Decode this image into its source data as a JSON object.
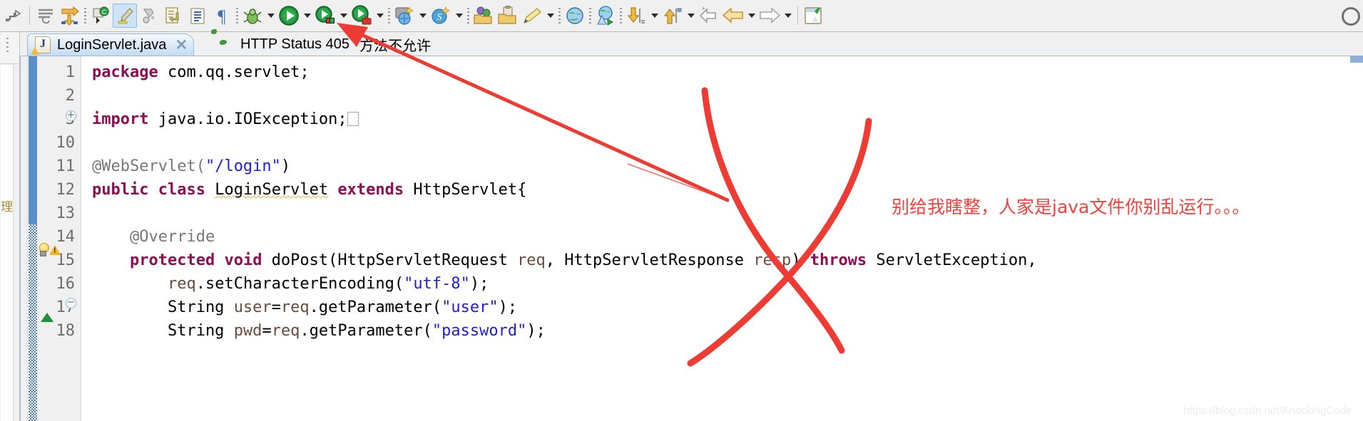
{
  "toolbar": {
    "items": [
      {
        "name": "link-with-editor-icon",
        "glyph": "↱"
      },
      {
        "name": "toggle-mark-occurrences-icon",
        "glyph": "≡"
      },
      {
        "name": "skip-all-breakpoints-icon",
        "glyph": "↠"
      },
      {
        "name": "new-java-class-icon",
        "glyph": "Ⓒ"
      },
      {
        "name": "toggle-highlight-icon",
        "glyph": "✎"
      },
      {
        "name": "toggle-block-selection-icon",
        "glyph": "❖"
      },
      {
        "name": "next-annotation-icon",
        "glyph": "↵"
      },
      {
        "name": "show-whitespace-icon",
        "glyph": "☰"
      },
      {
        "name": "paragraph-mark-icon",
        "glyph": "¶"
      },
      {
        "name": "debug-icon",
        "glyph": "🐞"
      },
      {
        "name": "run-icon",
        "glyph": "▶"
      },
      {
        "name": "run-external-tools-icon",
        "glyph": "▶"
      },
      {
        "name": "run-coverage-icon",
        "glyph": "▶"
      },
      {
        "name": "new-web-project-icon",
        "glyph": "✦"
      },
      {
        "name": "new-spring-bean-icon",
        "glyph": "✦"
      },
      {
        "name": "open-type-icon",
        "glyph": "📂"
      },
      {
        "name": "open-task-icon",
        "glyph": "📁"
      },
      {
        "name": "new-task-icon",
        "glyph": "✏"
      },
      {
        "name": "open-web-browser-icon",
        "glyph": "🌐"
      },
      {
        "name": "run-on-server-icon",
        "glyph": "🌍"
      },
      {
        "name": "previous-edit-location-icon",
        "glyph": "⬇"
      },
      {
        "name": "next-edit-location-icon",
        "glyph": "⬆"
      },
      {
        "name": "back-new-icon",
        "glyph": "↩"
      },
      {
        "name": "back-icon",
        "glyph": "⇦"
      },
      {
        "name": "forward-icon",
        "glyph": "⇨"
      },
      {
        "name": "open-perspective-icon",
        "glyph": "🗔"
      }
    ],
    "search_icon": "search-icon"
  },
  "left_rail": {
    "vertical_label": "理"
  },
  "tabs": [
    {
      "label": "LoginServlet.java",
      "suffix": "",
      "icon": "java-file-icon",
      "active": true,
      "closable": true,
      "close_glyph": "✕"
    },
    {
      "label": "HTTP Status 405",
      "suffix": "方法不允许",
      "icon": "web-browser-icon",
      "active": false,
      "closable": false,
      "close_glyph": ""
    }
  ],
  "editor": {
    "lines": [
      {
        "number": "1",
        "fold": "",
        "marker": "",
        "tokens": [
          {
            "t": "package",
            "c": "kw"
          },
          {
            "t": " com.qq.servlet;",
            "c": "plain"
          }
        ]
      },
      {
        "number": "2",
        "fold": "",
        "marker": "",
        "tokens": []
      },
      {
        "number": "3",
        "fold": "plus",
        "marker": "",
        "tokens": [
          {
            "t": "import",
            "c": "kw"
          },
          {
            "t": " java.io.IOException;",
            "c": "plain"
          },
          {
            "t": "⎕",
            "c": "collapsed"
          }
        ]
      },
      {
        "number": "10",
        "fold": "",
        "marker": "",
        "tokens": []
      },
      {
        "number": "11",
        "fold": "",
        "marker": "",
        "tokens": [
          {
            "t": "@WebServlet(",
            "c": "ann"
          },
          {
            "t": "\"/login\"",
            "c": "str"
          },
          {
            "t": ")",
            "c": "plain"
          }
        ]
      },
      {
        "number": "12",
        "fold": "",
        "marker": "warning-bulb",
        "tokens": [
          {
            "t": "public",
            "c": "kw"
          },
          {
            "t": " ",
            "c": "plain"
          },
          {
            "t": "class",
            "c": "kw"
          },
          {
            "t": " ",
            "c": "plain"
          },
          {
            "t": "LoginServlet",
            "c": "squiggle"
          },
          {
            "t": " ",
            "c": "plain"
          },
          {
            "t": "extends",
            "c": "kw"
          },
          {
            "t": " HttpServlet{",
            "c": "plain"
          }
        ]
      },
      {
        "number": "13",
        "fold": "",
        "marker": "",
        "tokens": []
      },
      {
        "number": "14",
        "fold": "minus",
        "marker": "",
        "tokens": [
          {
            "t": "    @Override",
            "c": "ann"
          }
        ]
      },
      {
        "number": "15",
        "fold": "",
        "marker": "override-arrow",
        "tokens": [
          {
            "t": "    ",
            "c": "plain"
          },
          {
            "t": "protected",
            "c": "kw"
          },
          {
            "t": " ",
            "c": "plain"
          },
          {
            "t": "void",
            "c": "kw"
          },
          {
            "t": " doPost(HttpServletRequest ",
            "c": "plain"
          },
          {
            "t": "req",
            "c": "fld"
          },
          {
            "t": ", HttpServletResponse ",
            "c": "plain"
          },
          {
            "t": "resp",
            "c": "fld"
          },
          {
            "t": ") ",
            "c": "plain"
          },
          {
            "t": "throws",
            "c": "kw"
          },
          {
            "t": " ServletException,",
            "c": "plain"
          }
        ]
      },
      {
        "number": "16",
        "fold": "",
        "marker": "",
        "tokens": [
          {
            "t": "        ",
            "c": "plain"
          },
          {
            "t": "req",
            "c": "fld"
          },
          {
            "t": ".setCharacterEncoding(",
            "c": "plain"
          },
          {
            "t": "\"utf-8\"",
            "c": "str"
          },
          {
            "t": ");",
            "c": "plain"
          }
        ]
      },
      {
        "number": "17",
        "fold": "",
        "marker": "",
        "tokens": [
          {
            "t": "        String ",
            "c": "plain"
          },
          {
            "t": "user",
            "c": "fld"
          },
          {
            "t": "=",
            "c": "plain"
          },
          {
            "t": "req",
            "c": "fld"
          },
          {
            "t": ".getParameter(",
            "c": "plain"
          },
          {
            "t": "\"user\"",
            "c": "str"
          },
          {
            "t": ");",
            "c": "plain"
          }
        ]
      },
      {
        "number": "18",
        "fold": "",
        "marker": "",
        "tokens": [
          {
            "t": "        String ",
            "c": "plain"
          },
          {
            "t": "pwd",
            "c": "fld"
          },
          {
            "t": "=",
            "c": "plain"
          },
          {
            "t": "req",
            "c": "fld"
          },
          {
            "t": ".getParameter(",
            "c": "plain"
          },
          {
            "t": "\"password\"",
            "c": "str"
          },
          {
            "t": ");",
            "c": "plain"
          }
        ]
      }
    ]
  },
  "annotations": {
    "note_text": "别给我瞎整，人家是java文件你别乱运行。。。",
    "note_color": "#f4413c",
    "mark_color": "#ee3b33",
    "arrow_label": "red-arrow-to-run-button",
    "cross_label": "red-cross-over-code"
  },
  "watermark": {
    "text": "https://blog.csdn.net/KnockingCode"
  }
}
